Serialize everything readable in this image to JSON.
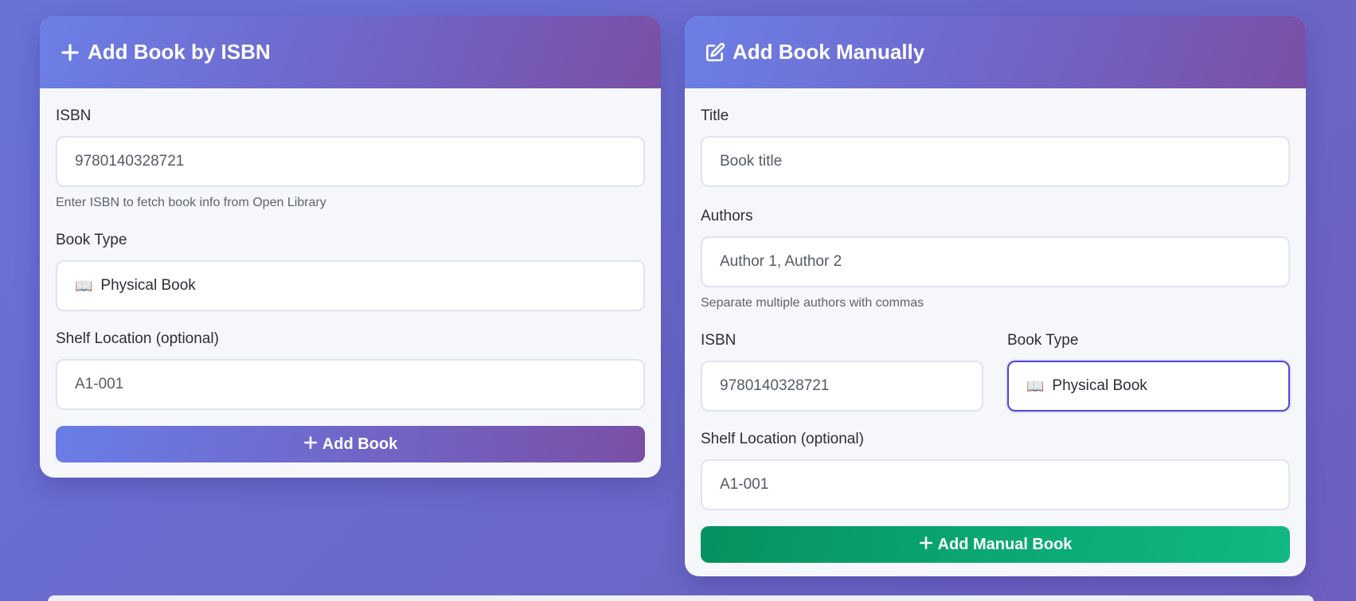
{
  "isbn_card": {
    "title": "Add Book by ISBN",
    "isbn_label": "ISBN",
    "isbn_placeholder": "9780140328721",
    "isbn_help": "Enter ISBN to fetch book info from Open Library",
    "type_label": "Book Type",
    "type_value": "Physical Book",
    "type_emoji": "📖",
    "shelf_label": "Shelf Location (optional)",
    "shelf_placeholder": "A1-001",
    "submit_label": "Add Book"
  },
  "manual_card": {
    "title": "Add Book Manually",
    "title_label": "Title",
    "title_placeholder": "Book title",
    "authors_label": "Authors",
    "authors_placeholder": "Author 1, Author 2",
    "authors_help": "Separate multiple authors with commas",
    "isbn_label": "ISBN",
    "isbn_placeholder": "9780140328721",
    "type_label": "Book Type",
    "type_value": "Physical Book",
    "type_emoji": "📖",
    "shelf_label": "Shelf Location (optional)",
    "shelf_placeholder": "A1-001",
    "submit_label": "Add Manual Book"
  },
  "colors": {
    "header_gradient_start": "#6c7fe6",
    "header_gradient_end": "#7a4fa6",
    "add_button_green": "#0aa872",
    "focus_border": "#4f46d6"
  },
  "icons": {
    "isbn_header_icon": "plus-icon",
    "manual_header_icon": "edit-icon",
    "button_icon": "plus-icon"
  }
}
